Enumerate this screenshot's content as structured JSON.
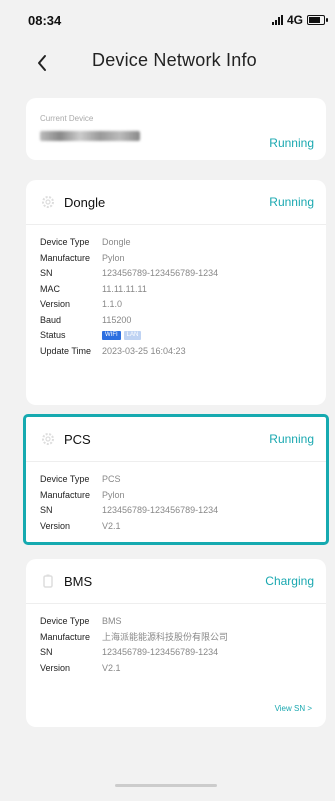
{
  "status_bar": {
    "time": "08:34",
    "network": "4G"
  },
  "header": {
    "title": "Device Network Info"
  },
  "current_device": {
    "label": "Current Device",
    "status": "Running"
  },
  "dongle": {
    "title": "Dongle",
    "status": "Running",
    "rows": [
      {
        "k": "Device Type",
        "v": "Dongle"
      },
      {
        "k": "Manufacture",
        "v": "Pylon"
      },
      {
        "k": "SN",
        "v": "123456789-123456789-1234"
      },
      {
        "k": "MAC",
        "v": "11.11.11.11"
      },
      {
        "k": "Version",
        "v": "1.1.0"
      },
      {
        "k": "Baud",
        "v": "115200"
      }
    ],
    "status_label": "Status",
    "badges": {
      "wifi": "WIFI",
      "lan": "LAN"
    },
    "update_label": "Update Time",
    "update_time": "2023-03-25 16:04:23"
  },
  "pcs": {
    "title": "PCS",
    "status": "Running",
    "rows": [
      {
        "k": "Device Type",
        "v": "PCS"
      },
      {
        "k": "Manufacture",
        "v": "Pylon"
      },
      {
        "k": "SN",
        "v": "123456789-123456789-1234"
      },
      {
        "k": "Version",
        "v": "V2.1"
      }
    ]
  },
  "bms": {
    "title": "BMS",
    "status": "Charging",
    "rows": [
      {
        "k": "Device Type",
        "v": "BMS"
      },
      {
        "k": "Manufacture",
        "v": "上海派能能源科技股份有限公司"
      },
      {
        "k": "SN",
        "v": "123456789-123456789-1234"
      },
      {
        "k": "Version",
        "v": "V2.1"
      }
    ],
    "view_sn": "View SN >"
  },
  "colors": {
    "accent": "#1aa8b0",
    "selection": "#16aab0"
  }
}
